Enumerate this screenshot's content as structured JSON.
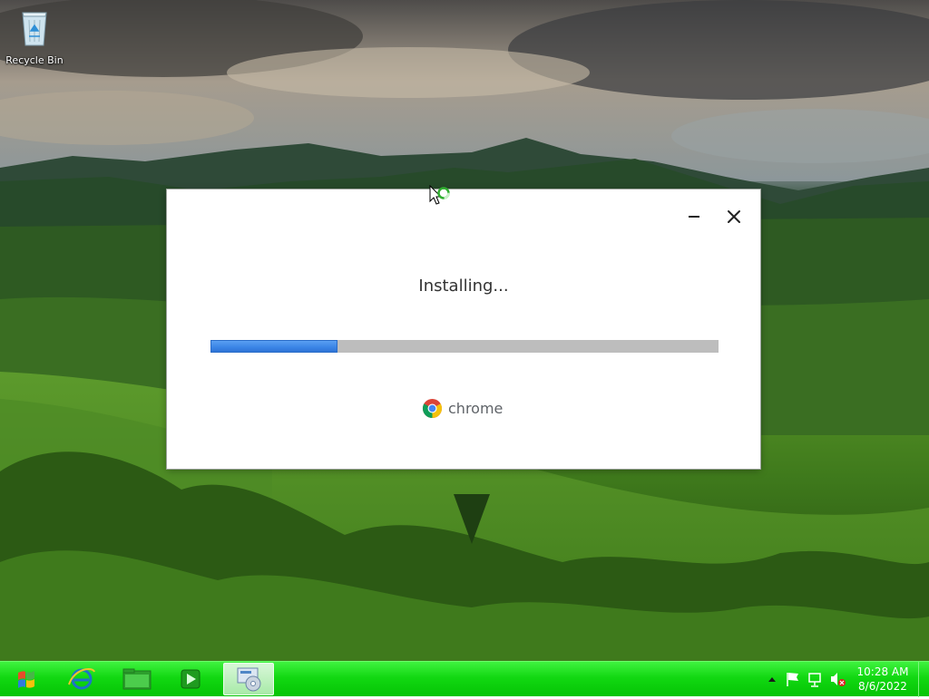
{
  "desktop": {
    "icons": [
      {
        "label": "Recycle Bin",
        "icon": "recycle-bin-icon"
      }
    ]
  },
  "installer": {
    "status_text": "Installing...",
    "progress_percent": 25,
    "brand_name": "chrome",
    "brand_icon": "chrome-logo-icon",
    "controls": [
      "minimize",
      "close"
    ]
  },
  "taskbar": {
    "color": "#12d812",
    "start_icon": "windows-logo-icon",
    "pinned": [
      {
        "icon": "internet-explorer-icon",
        "active": false
      },
      {
        "icon": "file-explorer-icon",
        "active": false
      },
      {
        "icon": "media-player-icon",
        "active": false
      },
      {
        "icon": "setup-installer-icon",
        "active": true
      }
    ],
    "tray": {
      "icons": [
        "show-hidden-icons-chevron",
        "action-center-flag-icon",
        "network-icon",
        "volume-muted-icon"
      ],
      "time": "10:28 AM",
      "date": "8/6/2022"
    }
  },
  "colors": {
    "progress_fill": "#3a84e6",
    "progress_track": "#bdbdbd"
  }
}
